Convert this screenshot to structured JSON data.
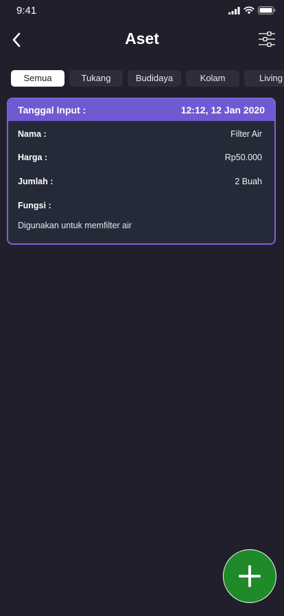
{
  "status_bar": {
    "time": "9:41"
  },
  "header": {
    "title": "Aset"
  },
  "tabs": [
    {
      "label": "Semua",
      "active": true
    },
    {
      "label": "Tukang",
      "active": false
    },
    {
      "label": "Budidaya",
      "active": false
    },
    {
      "label": "Kolam",
      "active": false
    },
    {
      "label": "Living",
      "active": false
    }
  ],
  "card": {
    "input_label": "Tanggal Input :",
    "input_date": "12:12, 12 Jan 2020",
    "fields": [
      {
        "label": "Nama :",
        "value": "Filter Air"
      },
      {
        "label": "Harga :",
        "value": "Rp50.000"
      },
      {
        "label": "Jumlah :",
        "value": "2 Buah"
      },
      {
        "label": "Fungsi :",
        "value": ""
      }
    ],
    "description": "Digunakan untuk memfilter air"
  },
  "fab": {
    "icon": "plus-icon"
  },
  "colors": {
    "background": "#221f2c",
    "accent": "#6f5ad1",
    "card_border": "#7a63d8",
    "fab": "#1f8a2a",
    "tab_inactive": "#2f2c3b"
  }
}
